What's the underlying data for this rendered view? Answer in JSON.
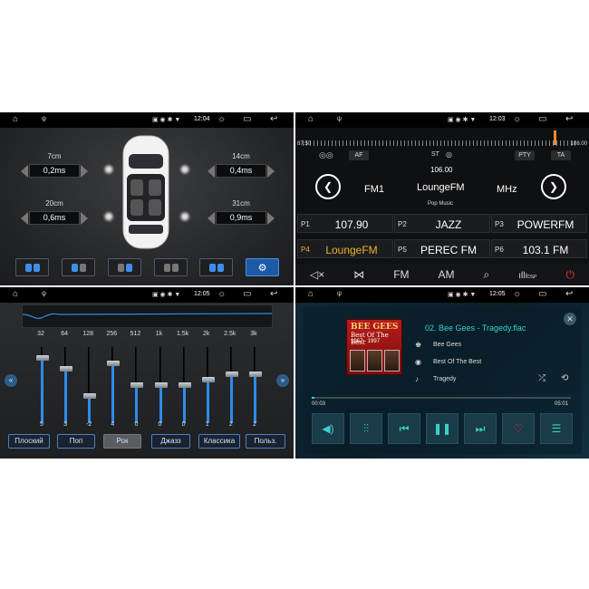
{
  "status_left": {
    "time": "12:04"
  },
  "status_right": {
    "time": "12:03"
  },
  "status_bl": {
    "time": "12:05"
  },
  "status_br": {
    "time": "12:05"
  },
  "sound_field": {
    "seats": [
      {
        "label": "7cm",
        "value": "0,2ms"
      },
      {
        "label": "14cm",
        "value": "0,4ms"
      },
      {
        "label": "20cm",
        "value": "0,6ms"
      },
      {
        "label": "31cm",
        "value": "0,9ms"
      }
    ]
  },
  "radio": {
    "scale_min": "87.50",
    "scale_max": "108.00",
    "af": "AF",
    "st": "ST",
    "pty": "PTY",
    "ta": "TA",
    "frequency": "106.00",
    "band": "FM1",
    "station": "LoungeFM",
    "unit": "MHz",
    "genre": "Pop Music",
    "presets": [
      {
        "num": "P1",
        "name": "107.90"
      },
      {
        "num": "P2",
        "name": "JAZZ"
      },
      {
        "num": "P3",
        "name": "POWERFM"
      },
      {
        "num": "P4",
        "name": "LoungeFM"
      },
      {
        "num": "P5",
        "name": "PEREC FM"
      },
      {
        "num": "P6",
        "name": "103.1 FM"
      }
    ],
    "bottom": {
      "fm": "FM",
      "am": "AM",
      "dsp": "DSP"
    }
  },
  "eq": {
    "freqs": [
      "32",
      "64",
      "128",
      "256",
      "512",
      "1k",
      "1.5k",
      "2k",
      "2.5k",
      "3k"
    ],
    "values": [
      "5",
      "3",
      "-2",
      "4",
      "0",
      "0",
      "0",
      "1",
      "2",
      "2"
    ],
    "presets": [
      "Плоский",
      "Поп",
      "Рок",
      "Джазз",
      "Классика",
      "Польз."
    ]
  },
  "player": {
    "track": "02. Bee Gees - Tragedy.flac",
    "artist": "Bee Gees",
    "album": "Best Of The Best",
    "title": "Tragedy",
    "elapsed": "00:03",
    "total": "05:01",
    "progress": 0.01,
    "art_title": "BEE GEES",
    "art_sub": "Best Of The Best",
    "art_years": "1967 - 1997"
  },
  "colors": {
    "accent_blue": "#2d8ce8",
    "radio_active": "#f0b429",
    "player_accent": "#3ad1c8",
    "power_red": "#e53935"
  }
}
